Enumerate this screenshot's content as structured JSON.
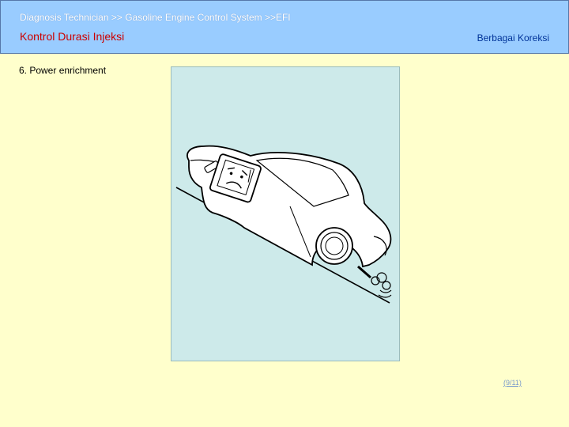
{
  "header": {
    "breadcrumb": "Diagnosis Technician >> Gasoline Engine Control System >>EFI",
    "title": "Kontrol Durasi Injeksi",
    "subtitle": "Berbagai Koreksi"
  },
  "content": {
    "section_label": "6. Power enrichment"
  },
  "footer": {
    "page_number": "(9/11)"
  },
  "colors": {
    "background": "#ffffcc",
    "header": "#99ccff",
    "title": "#cc0000",
    "subtitle": "#003399",
    "figure_bg": "#cdeaea"
  }
}
